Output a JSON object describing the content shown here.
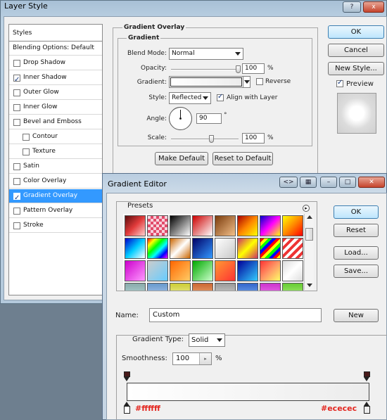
{
  "layer_style": {
    "title": "Layer Style",
    "help_button": "?",
    "close_button": "x",
    "styles_header": "Styles",
    "styles": [
      {
        "label": "Blending Options: Default",
        "checkbox": false,
        "checked": false,
        "selected": false
      },
      {
        "label": "Drop Shadow",
        "checkbox": true,
        "checked": false,
        "selected": false
      },
      {
        "label": "Inner Shadow",
        "checkbox": true,
        "checked": true,
        "selected": false
      },
      {
        "label": "Outer Glow",
        "checkbox": true,
        "checked": false,
        "selected": false
      },
      {
        "label": "Inner Glow",
        "checkbox": true,
        "checked": false,
        "selected": false
      },
      {
        "label": "Bevel and Emboss",
        "checkbox": true,
        "checked": false,
        "selected": false
      },
      {
        "label": "Contour",
        "checkbox": true,
        "checked": false,
        "selected": false,
        "indent": true
      },
      {
        "label": "Texture",
        "checkbox": true,
        "checked": false,
        "selected": false,
        "indent": true
      },
      {
        "label": "Satin",
        "checkbox": true,
        "checked": false,
        "selected": false
      },
      {
        "label": "Color Overlay",
        "checkbox": true,
        "checked": false,
        "selected": false
      },
      {
        "label": "Gradient Overlay",
        "checkbox": true,
        "checked": true,
        "selected": true
      },
      {
        "label": "Pattern Overlay",
        "checkbox": true,
        "checked": false,
        "selected": false
      },
      {
        "label": "Stroke",
        "checkbox": true,
        "checked": false,
        "selected": false
      }
    ],
    "panel_title": "Gradient Overlay",
    "group_title": "Gradient",
    "blend_mode_label": "Blend Mode:",
    "blend_mode_value": "Normal",
    "opacity_label": "Opacity:",
    "opacity_value": "100",
    "opacity_percent": 100,
    "percent_sign": "%",
    "gradient_label": "Gradient:",
    "reverse_label": "Reverse",
    "reverse_checked": false,
    "style_label": "Style:",
    "style_value": "Reflected",
    "align_label": "Align with Layer",
    "align_checked": true,
    "angle_label": "Angle:",
    "angle_value": "90",
    "angle_degrees": 90,
    "degree_sign": "°",
    "scale_label": "Scale:",
    "scale_value": "100",
    "scale_percent": 100,
    "make_default_label": "Make Default",
    "reset_default_label": "Reset to Default",
    "ok_label": "OK",
    "cancel_label": "Cancel",
    "new_style_label": "New Style...",
    "preview_label": "Preview",
    "preview_checked": true
  },
  "gradient_editor": {
    "title": "Gradient Editor",
    "presets_label": "Presets",
    "ok_label": "OK",
    "reset_label": "Reset",
    "load_label": "Load...",
    "save_label": "Save...",
    "name_label": "Name:",
    "name_value": "Custom",
    "new_label": "New",
    "gradient_type_label": "Gradient Type:",
    "gradient_type_value": "Solid",
    "smoothness_label": "Smoothness:",
    "smoothness_value": "100",
    "percent_sign": "%",
    "left_stop_color": "#ffffff",
    "right_stop_color": "#ececec",
    "left_stop_label": "#ffffff",
    "right_stop_label": "#ececec"
  },
  "colors": {
    "selection": "#3399ff",
    "stop_label": "#e3261f"
  }
}
